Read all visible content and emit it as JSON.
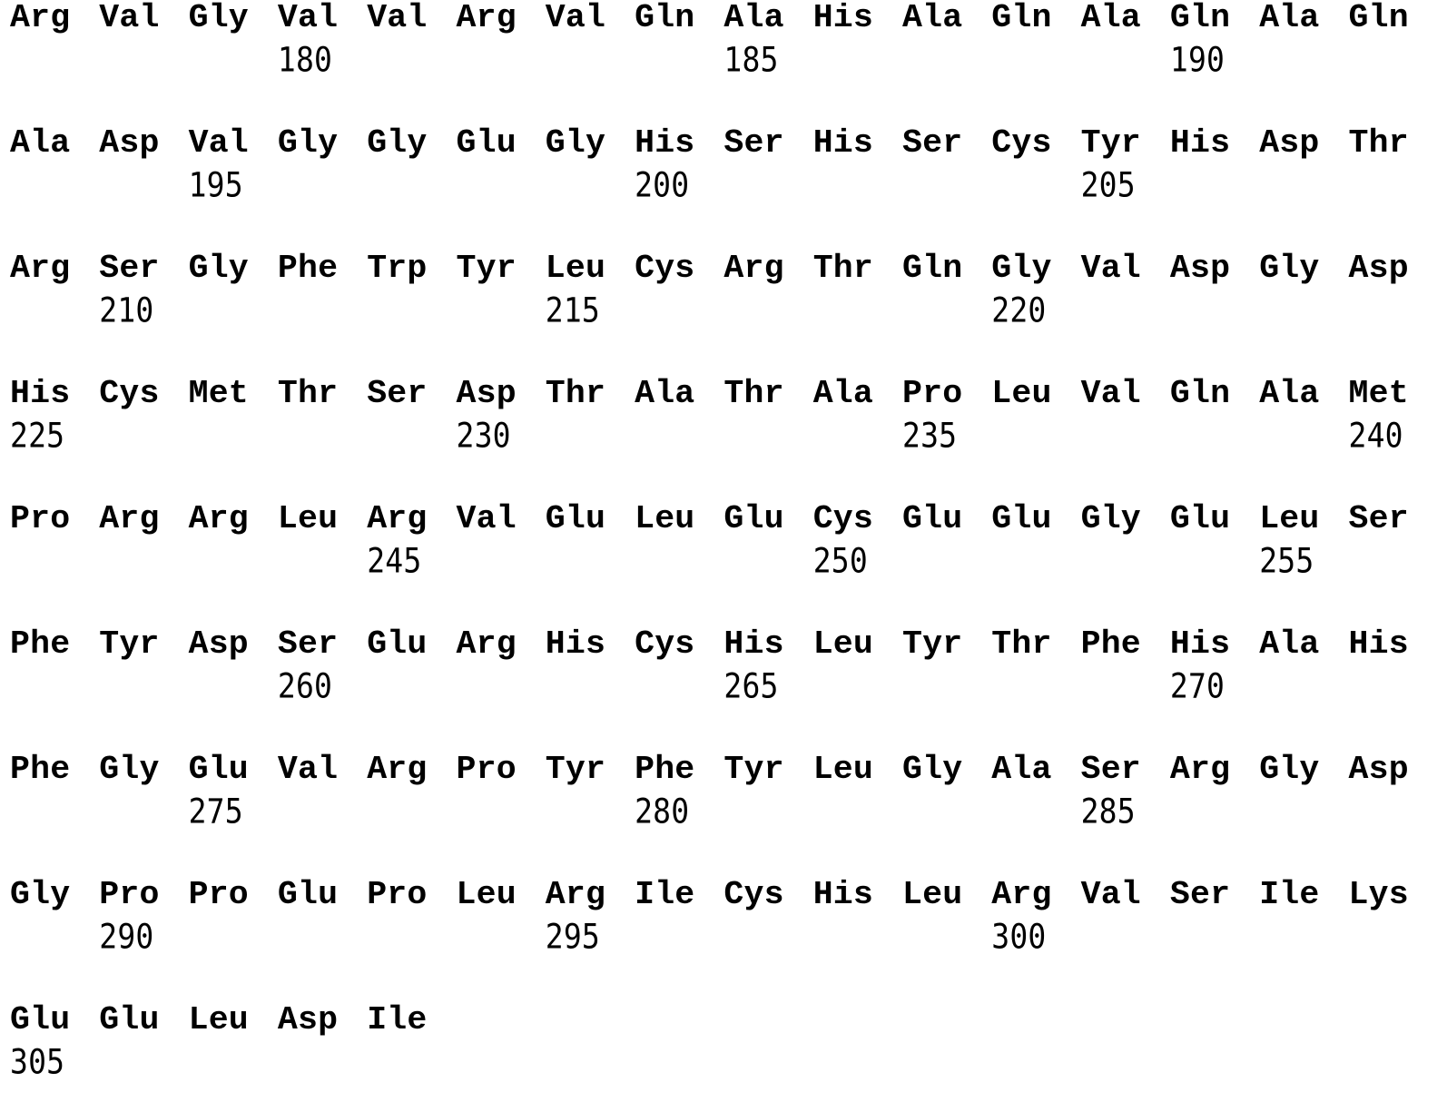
{
  "sequence_listing": {
    "blocks": [
      {
        "residues": [
          "Arg",
          "Val",
          "Gly",
          "Val",
          "Val",
          "Arg",
          "Val",
          "Gln",
          "Ala",
          "His",
          "Ala",
          "Gln",
          "Ala",
          "Gln",
          "Ala",
          "Gln"
        ],
        "numbers": [
          {
            "value": "180",
            "column": 4
          },
          {
            "value": "185",
            "column": 9
          },
          {
            "value": "190",
            "column": 14
          }
        ]
      },
      {
        "residues": [
          "Ala",
          "Asp",
          "Val",
          "Gly",
          "Gly",
          "Glu",
          "Gly",
          "His",
          "Ser",
          "His",
          "Ser",
          "Cys",
          "Tyr",
          "His",
          "Asp",
          "Thr"
        ],
        "numbers": [
          {
            "value": "195",
            "column": 3
          },
          {
            "value": "200",
            "column": 8
          },
          {
            "value": "205",
            "column": 13
          }
        ]
      },
      {
        "residues": [
          "Arg",
          "Ser",
          "Gly",
          "Phe",
          "Trp",
          "Tyr",
          "Leu",
          "Cys",
          "Arg",
          "Thr",
          "Gln",
          "Gly",
          "Val",
          "Asp",
          "Gly",
          "Asp"
        ],
        "numbers": [
          {
            "value": "210",
            "column": 2
          },
          {
            "value": "215",
            "column": 7
          },
          {
            "value": "220",
            "column": 12
          }
        ]
      },
      {
        "residues": [
          "His",
          "Cys",
          "Met",
          "Thr",
          "Ser",
          "Asp",
          "Thr",
          "Ala",
          "Thr",
          "Ala",
          "Pro",
          "Leu",
          "Val",
          "Gln",
          "Ala",
          "Met"
        ],
        "numbers": [
          {
            "value": "225",
            "column": 1
          },
          {
            "value": "230",
            "column": 6
          },
          {
            "value": "235",
            "column": 11
          },
          {
            "value": "240",
            "column": 16
          }
        ]
      },
      {
        "residues": [
          "Pro",
          "Arg",
          "Arg",
          "Leu",
          "Arg",
          "Val",
          "Glu",
          "Leu",
          "Glu",
          "Cys",
          "Glu",
          "Glu",
          "Gly",
          "Glu",
          "Leu",
          "Ser"
        ],
        "numbers": [
          {
            "value": "245",
            "column": 5
          },
          {
            "value": "250",
            "column": 10
          },
          {
            "value": "255",
            "column": 15
          }
        ]
      },
      {
        "residues": [
          "Phe",
          "Tyr",
          "Asp",
          "Ser",
          "Glu",
          "Arg",
          "His",
          "Cys",
          "His",
          "Leu",
          "Tyr",
          "Thr",
          "Phe",
          "His",
          "Ala",
          "His"
        ],
        "numbers": [
          {
            "value": "260",
            "column": 4
          },
          {
            "value": "265",
            "column": 9
          },
          {
            "value": "270",
            "column": 14
          }
        ]
      },
      {
        "residues": [
          "Phe",
          "Gly",
          "Glu",
          "Val",
          "Arg",
          "Pro",
          "Tyr",
          "Phe",
          "Tyr",
          "Leu",
          "Gly",
          "Ala",
          "Ser",
          "Arg",
          "Gly",
          "Asp"
        ],
        "numbers": [
          {
            "value": "275",
            "column": 3
          },
          {
            "value": "280",
            "column": 8
          },
          {
            "value": "285",
            "column": 13
          }
        ]
      },
      {
        "residues": [
          "Gly",
          "Pro",
          "Pro",
          "Glu",
          "Pro",
          "Leu",
          "Arg",
          "Ile",
          "Cys",
          "His",
          "Leu",
          "Arg",
          "Val",
          "Ser",
          "Ile",
          "Lys"
        ],
        "numbers": [
          {
            "value": "290",
            "column": 2
          },
          {
            "value": "295",
            "column": 7
          },
          {
            "value": "300",
            "column": 12
          }
        ]
      },
      {
        "residues": [
          "Glu",
          "Glu",
          "Leu",
          "Asp",
          "Ile"
        ],
        "numbers": [
          {
            "value": "305",
            "column": 1
          }
        ]
      }
    ]
  }
}
